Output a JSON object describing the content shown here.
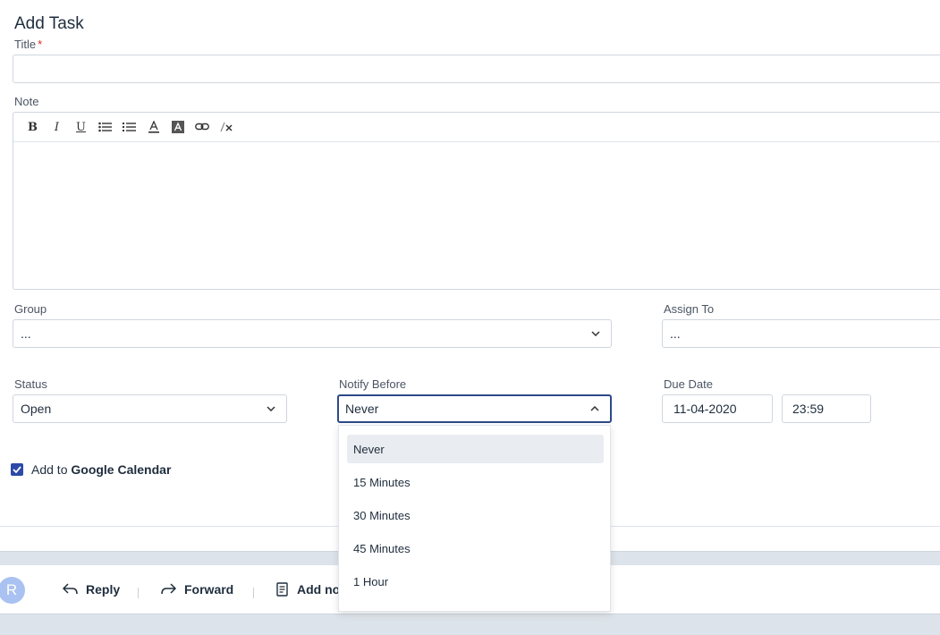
{
  "form": {
    "heading": "Add Task",
    "title_label": "Title",
    "required_mark": "*",
    "title_value": "",
    "note_label": "Note",
    "group_label": "Group",
    "group_value": "...",
    "assign_label": "Assign To",
    "assign_value": "...",
    "status_label": "Status",
    "status_value": "Open",
    "notify_label": "Notify Before",
    "notify_value": "Never",
    "due_label": "Due Date",
    "due_date": "11-04-2020",
    "due_time": "23:59",
    "calendar_prefix": "Add to",
    "calendar_name": "Google Calendar",
    "calendar_checked": true
  },
  "toolbar": {
    "buttons": [
      {
        "name": "bold",
        "glyph": "B"
      },
      {
        "name": "italic",
        "glyph": "I"
      },
      {
        "name": "underline",
        "glyph": "U"
      },
      {
        "name": "bulleted-list",
        "glyph": "list-ul"
      },
      {
        "name": "numbered-list",
        "glyph": "list-ol"
      },
      {
        "name": "text-color",
        "glyph": "A"
      },
      {
        "name": "background-color",
        "glyph": "A"
      },
      {
        "name": "link",
        "glyph": "link"
      },
      {
        "name": "clear-format",
        "glyph": "Tx"
      }
    ]
  },
  "dropdown": {
    "options": [
      "Never",
      "15 Minutes",
      "30 Minutes",
      "45 Minutes",
      "1 Hour"
    ],
    "selected_index": 0
  },
  "actions": {
    "avatar_letter": "R",
    "reply": "Reply",
    "forward": "Forward",
    "add_note": "Add no"
  },
  "colors": {
    "accent": "#2d4a8a",
    "checkbox": "#2d4aa8",
    "avatar": "#a9c2f1",
    "strip": "#dde3ea"
  }
}
